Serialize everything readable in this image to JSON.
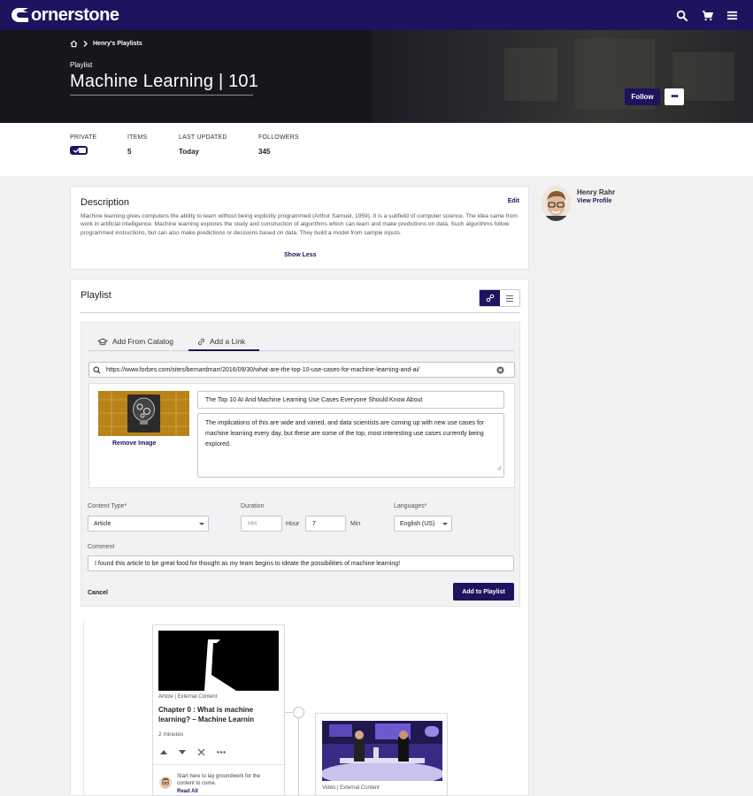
{
  "brand": {
    "name": "ornerstone",
    "primary": "#1c145e"
  },
  "nav": {
    "icons": [
      "search-icon",
      "cart-icon",
      "menu-icon"
    ]
  },
  "hero": {
    "breadcrumb": "Henry's Playlists",
    "kind": "Playlist",
    "title": "Machine Learning | 101",
    "follow_label": "Follow",
    "more_label": "•••"
  },
  "stats": [
    {
      "label": "PRIVATE",
      "value": ""
    },
    {
      "label": "ITEMS",
      "value": "5"
    },
    {
      "label": "LAST UPDATED",
      "value": "Today"
    },
    {
      "label": "FOLLOWERS",
      "value": "345"
    }
  ],
  "description": {
    "title": "Description",
    "edit": "Edit",
    "text": "Machine learning gives computers the ability to learn without being explicitly programmed (Arthur Samuel, 1959). It is a subfield of computer science. The idea came from work in artificial intelligence. Machine learning explores the study and construction of algorithms which can learn and make predictions on data. Such algorithms follow programmed instructions, but can also make predictions or decisions based on data. They build a model from sample inputs.",
    "show_less": "Show Less"
  },
  "profile": {
    "name": "Henry Rahr",
    "link": "View Profile"
  },
  "playlist": {
    "title": "Playlist",
    "tabs": [
      "Add From Catalog",
      "Add a Link"
    ],
    "active_tab": 1,
    "url": "https://www.forbes.com/sites/bernardmarr/2016/09/30/what-are-the-top-10-use-cases-for-machine-learning-and-ai/",
    "remove_image": "Remove Image",
    "link_title": "The Top 10 AI And Machine Learning Use Cases Everyone Should Know About",
    "link_description": "The implications of this are wide and varied, and data scientists are coming up with new use cases for machine learning every day, but these are some of the top, most interesting use cases currently being explored.",
    "content_type": {
      "label": "Content Type",
      "required": "*",
      "value": "Article"
    },
    "duration": {
      "label": "Duration",
      "hours_placeholder": "HH",
      "hour_unit": "Hour",
      "minutes": "7",
      "min_unit": "Min"
    },
    "languages": {
      "label": "Languages",
      "required": "*",
      "value": "English (US)"
    },
    "comment": {
      "label": "Comment",
      "value": "I found this article to be great food for thought as my team begins to ideate the possibilities of machine learning!"
    },
    "cancel": "Cancel",
    "add_button": "Add to Playlist"
  },
  "items": [
    {
      "meta": "Article | External Content",
      "title_1": "Chapter 0 : What is machine",
      "title_2": "learning? – Machine Learnin",
      "duration": "2 minutes",
      "note_1": "Start here to lay groundwork for the",
      "note_2": "content to come.",
      "read_all": "Read All"
    },
    {
      "meta": "Video | External Content"
    }
  ]
}
